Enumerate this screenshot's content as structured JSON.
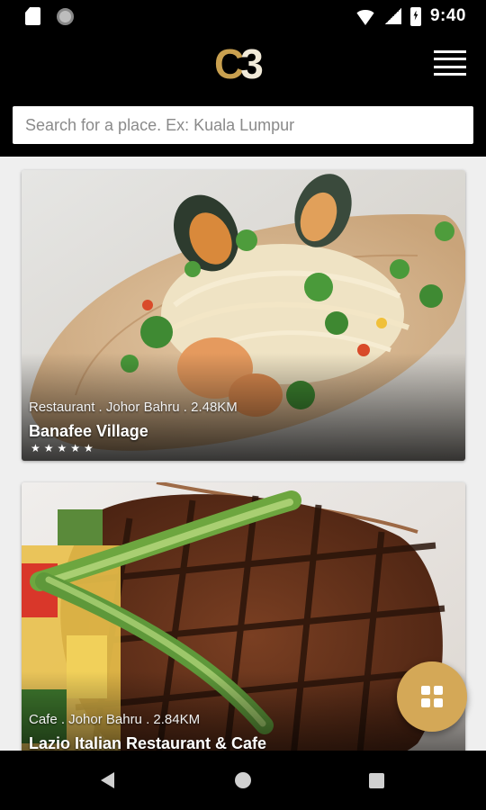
{
  "status_bar": {
    "time": "9:40"
  },
  "header": {
    "logo_c": "C",
    "logo_3": "3",
    "search_placeholder": "Search for a place. Ex: Kuala Lumpur"
  },
  "cards": [
    {
      "category": "Restaurant",
      "location": "Johor Bahru",
      "distance": "2.48KM",
      "meta": "Restaurant . Johor Bahru . 2.48KM",
      "name": "Banafee Village",
      "rating": 5,
      "stars_text": "★★★★★"
    },
    {
      "category": "Cafe",
      "location": "Johor Bahru",
      "distance": "2.84KM",
      "meta": "Cafe  . Johor Bahru . 2.84KM",
      "name": "Lazio Italian Restaurant & Cafe"
    }
  ],
  "icons": {
    "menu": "hamburger-menu-icon",
    "fab": "grid-icon",
    "nav_back": "back-triangle-icon",
    "nav_home": "home-circle-icon",
    "nav_recents": "recents-square-icon"
  },
  "colors": {
    "accent": "#d4a857",
    "logo_gold": "#c9a04f",
    "bar_background": "#000000"
  }
}
